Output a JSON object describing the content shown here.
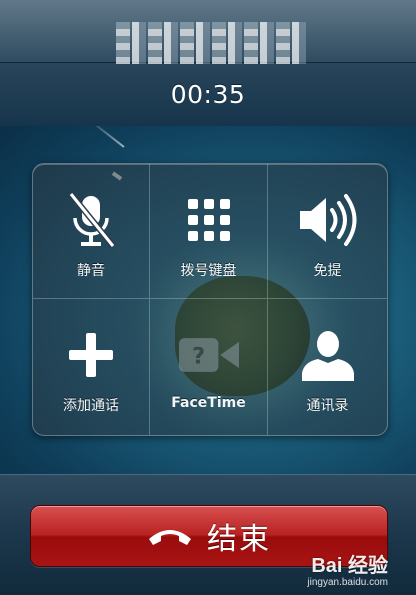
{
  "call": {
    "timer": "00:35"
  },
  "buttons": [
    {
      "label": "静音",
      "icon": "mute-icon"
    },
    {
      "label": "拨号键盘",
      "icon": "keypad-icon"
    },
    {
      "label": "免提",
      "icon": "speaker-icon"
    },
    {
      "label": "添加通话",
      "icon": "add-call-icon"
    },
    {
      "label": "FaceTime",
      "icon": "facetime-icon",
      "disabled": true
    },
    {
      "label": "通讯录",
      "icon": "contacts-icon"
    }
  ],
  "end_call": {
    "label": "结束",
    "color": "#b82222",
    "icon": "end-call-phone-icon"
  },
  "watermark": {
    "brand": "Bai 经验",
    "url": "jingyan.baidu.com"
  }
}
